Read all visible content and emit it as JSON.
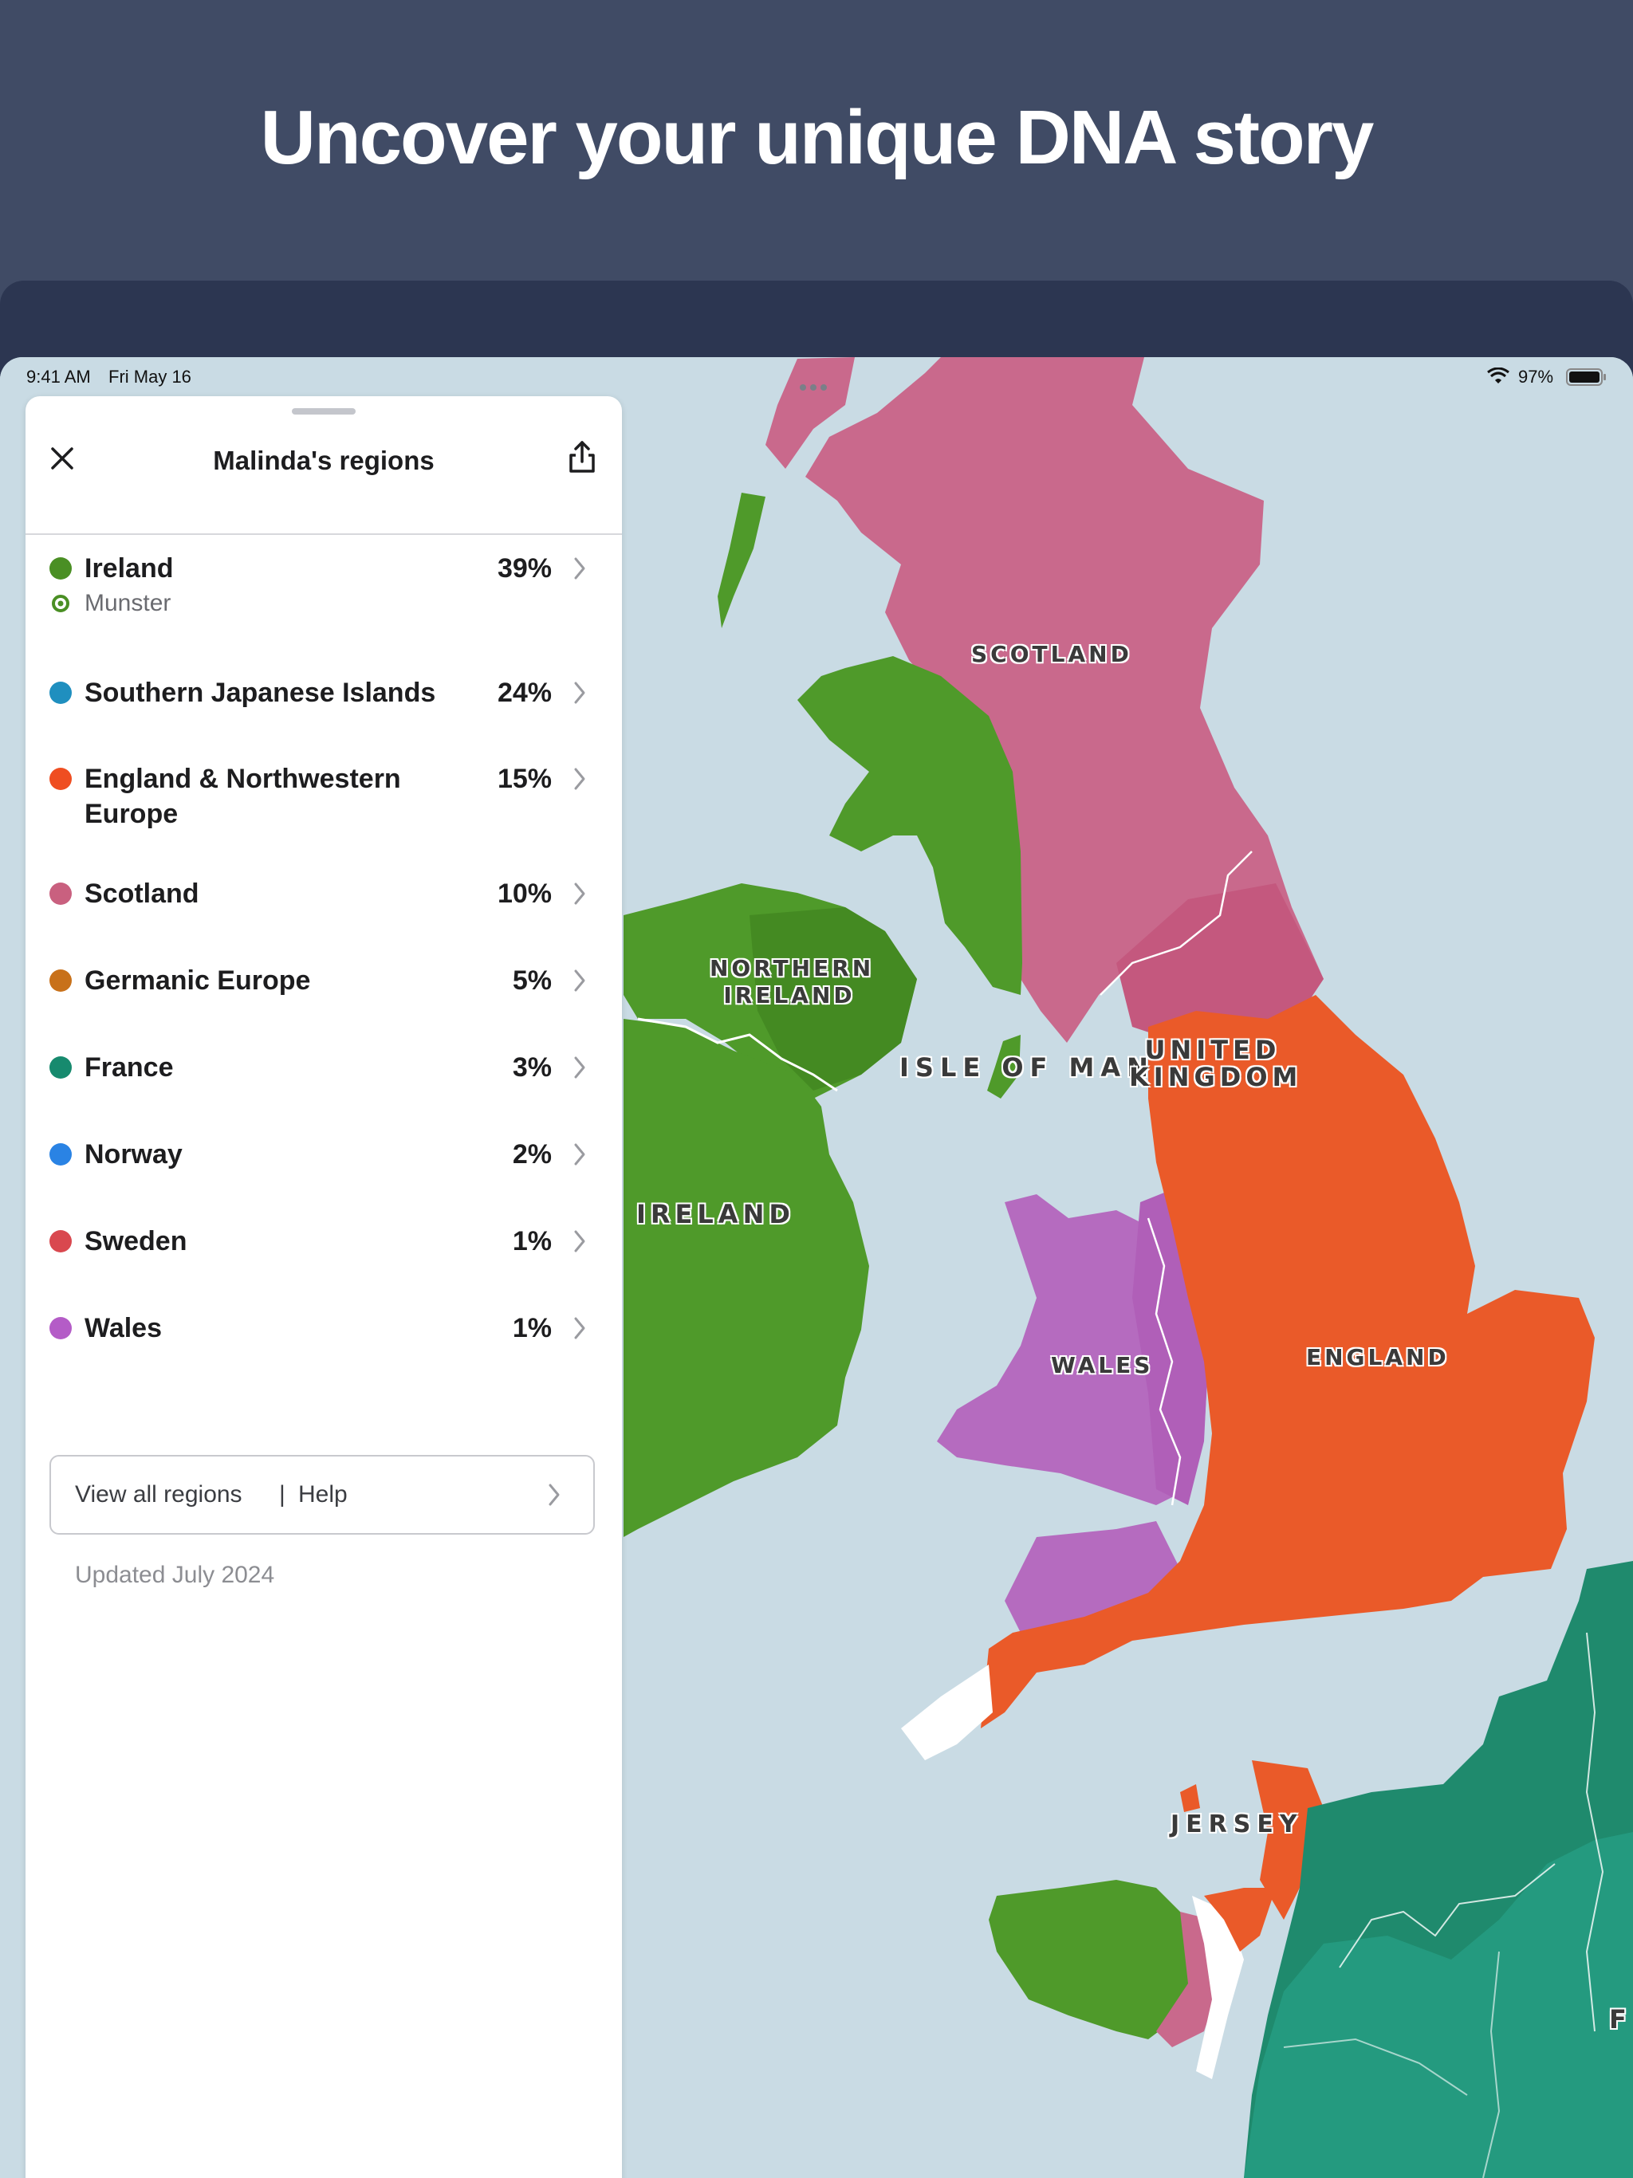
{
  "hero": {
    "title": "Uncover your unique DNA story"
  },
  "statusbar": {
    "time": "9:41 AM",
    "date": "Fri May 16",
    "battery": "97%"
  },
  "panel": {
    "title": "Malinda's regions",
    "close_icon": "close-icon",
    "share_icon": "share-icon",
    "regions": [
      {
        "name": "Ireland",
        "percent": "39%",
        "color": "#4a8f24",
        "subregion": "Munster"
      },
      {
        "name": "Southern Japanese Islands",
        "percent": "24%",
        "color": "#1f8fbf"
      },
      {
        "name": "England & Northwestern",
        "name2": "Europe",
        "percent": "15%",
        "color": "#ef4e21"
      },
      {
        "name": "Scotland",
        "percent": "10%",
        "color": "#c9607f"
      },
      {
        "name": "Germanic Europe",
        "percent": "5%",
        "color": "#c8711a"
      },
      {
        "name": "France",
        "percent": "3%",
        "color": "#178a6e"
      },
      {
        "name": "Norway",
        "percent": "2%",
        "color": "#2a83e4"
      },
      {
        "name": "Sweden",
        "percent": "1%",
        "color": "#d9484f"
      },
      {
        "name": "Wales",
        "percent": "1%",
        "color": "#b45cc7"
      }
    ],
    "footer": {
      "view_all": "View all regions",
      "separator": "|",
      "help": "Help"
    },
    "updated": "Updated July 2024"
  },
  "map": {
    "labels": {
      "scotland": "SCOTLAND",
      "northern_ireland_1": "NORTHERN",
      "northern_ireland_2": "IRELAND",
      "isle_of_man": "ISLE OF MAN",
      "uk_1": "UNITED",
      "uk_2": "KINGDOM",
      "ireland": "IRELAND",
      "wales": "WALES",
      "england": "ENGLAND",
      "jersey": "JERSEY",
      "france_partial": "F"
    },
    "colors": {
      "water": "#c9dbe4",
      "ireland": "#4f9a2a",
      "scotland": "#c9698c",
      "england": "#ea5a29",
      "wales": "#b56bbf",
      "france": "#1f8a6d",
      "france_light": "#249a7f"
    }
  }
}
